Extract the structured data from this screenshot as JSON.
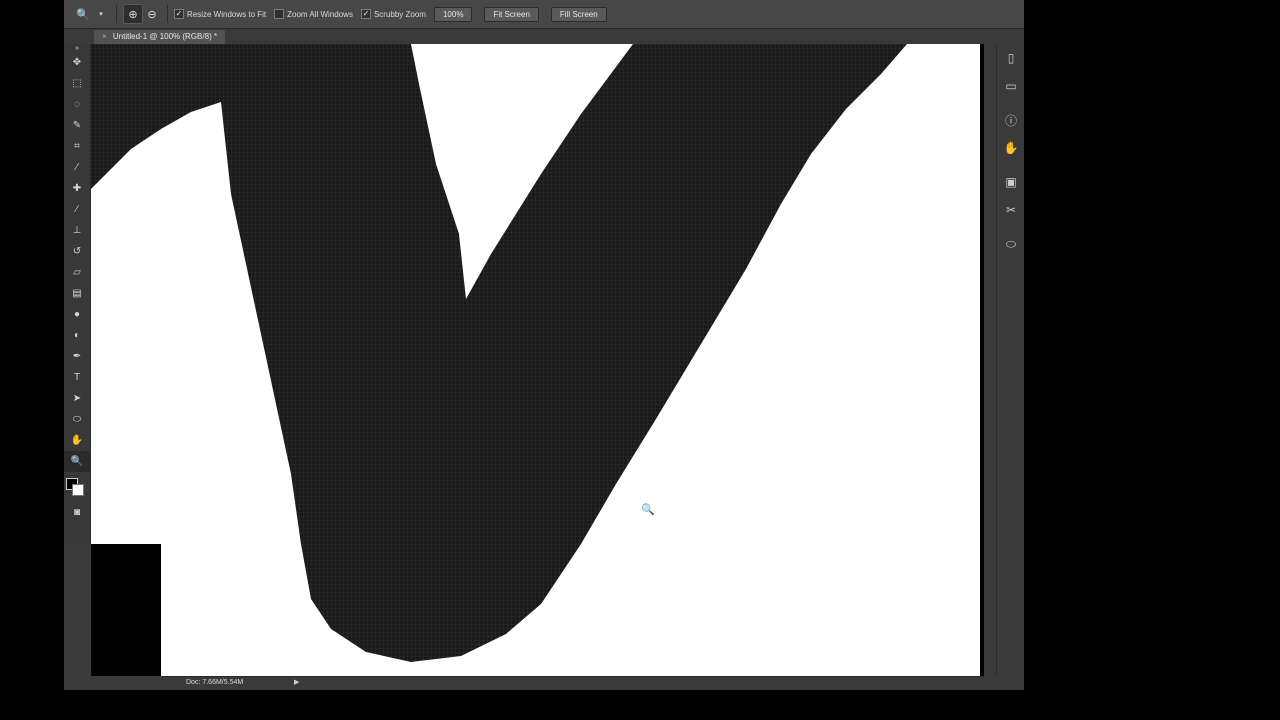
{
  "options_bar": {
    "checkbox_resize": "Resize Windows to Fit",
    "checkbox_zoom_all": "Zoom All Windows",
    "checkbox_scrubby": "Scrubby Zoom",
    "btn_100": "100%",
    "btn_fit": "Fit Screen",
    "btn_fill": "Fill Screen"
  },
  "document": {
    "tab_title": "Untitled-1 @ 100% (RGB/8) *",
    "tab_close": "×"
  },
  "status": {
    "doc_info": "Doc: 7.66M/5.54M",
    "arrow": "▶"
  },
  "tools": [
    "move",
    "marquee",
    "lasso",
    "quick-select",
    "crop",
    "eyedropper",
    "spot-heal",
    "brush",
    "stamp",
    "history-brush",
    "eraser",
    "gradient",
    "blur",
    "dodge",
    "pen",
    "type",
    "path-select",
    "shape",
    "hand",
    "zoom"
  ],
  "tool_glyphs": {
    "move": "✥",
    "marquee": "⬚",
    "lasso": "◌",
    "quick-select": "✎",
    "crop": "⌗",
    "eyedropper": "⁄",
    "spot-heal": "✚",
    "brush": "∕",
    "stamp": "⊥",
    "history-brush": "↺",
    "eraser": "▱",
    "gradient": "▤",
    "blur": "●",
    "dodge": "◐",
    "pen": "✒",
    "type": "T",
    "path-select": "➤",
    "shape": "⬭",
    "hand": "✋",
    "zoom": "🔍"
  },
  "dock_glyphs": [
    "▯",
    "▭",
    "ⓘ",
    "✋",
    "▣",
    "✂",
    "⬭"
  ],
  "colors": {
    "foreground": "#000000",
    "background": "#ffffff"
  }
}
